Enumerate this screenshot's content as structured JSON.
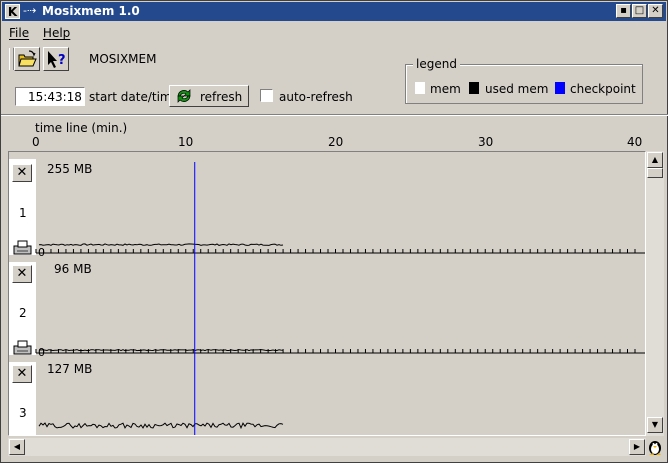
{
  "window": {
    "title": "Mosixmem 1.0",
    "app_icon": "K",
    "arrows": "-⇢"
  },
  "menu": {
    "file": "File",
    "help": "Help"
  },
  "toolbar": {
    "app_name": "MOSIXMEM",
    "open_icon": "folder-open-icon",
    "help_icon": "whats-this-help-icon"
  },
  "controls": {
    "time_value": "15:43:18",
    "start_label": "start date/time",
    "refresh_label": "refresh",
    "auto_refresh_label": "auto-refresh",
    "auto_refresh_checked": false
  },
  "legend": {
    "title": "legend",
    "items": [
      {
        "label": "mem",
        "color": "#ffffff"
      },
      {
        "label": "used mem",
        "color": "#000000"
      },
      {
        "label": "checkpoint",
        "color": "#0000ff"
      }
    ]
  },
  "timeline": {
    "label": "time line (min.)",
    "ticks": [
      "0",
      "10",
      "20",
      "30",
      "40"
    ],
    "min": 0,
    "max": 40,
    "checkpoint_minute": 10.6
  },
  "nodes": [
    {
      "id": "1",
      "max_label": "255 MB",
      "zero_label": "0"
    },
    {
      "id": "2",
      "max_label": "96 MB",
      "zero_label": "0"
    },
    {
      "id": "3",
      "max_label": "127 MB",
      "zero_label": ""
    }
  ],
  "colors": {
    "title_bar": "#244a8d",
    "checkpoint": "#0000ff",
    "window_bg": "#d4d0c8"
  }
}
